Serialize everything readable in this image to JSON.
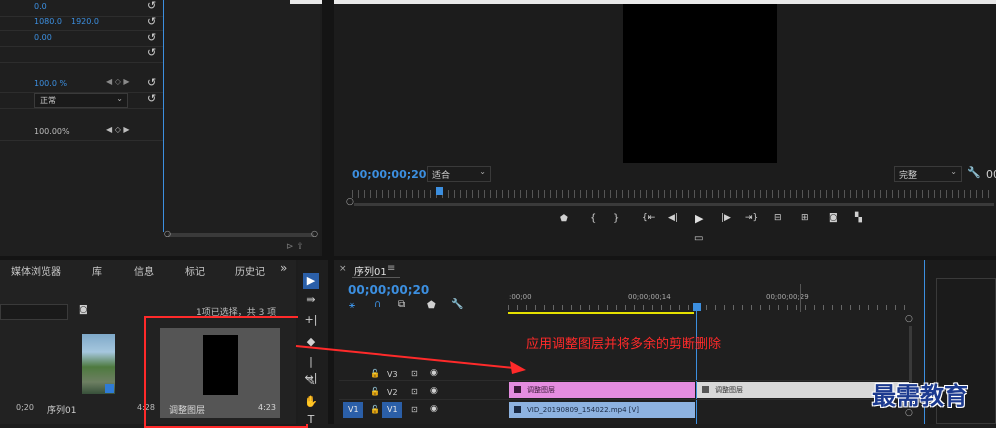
{
  "colors": {
    "accent_blue": "#3c8fe0",
    "adjustment_clip": "#e58de0",
    "video_clip": "#8db2e0",
    "annotation_red": "#ff2a2a",
    "playhead": "#3c8fe0",
    "work_area": "#e5e000"
  },
  "effect_controls": {
    "rows": [
      {
        "value_a": "0.0",
        "value_b": ""
      },
      {
        "value_a": "1080.0",
        "value_b": "1920.0"
      },
      {
        "value_a": "0.00",
        "value_b": ""
      },
      {
        "value_a": "",
        "value_b": ""
      },
      {
        "value_a": "100.0 %",
        "value_b": ""
      },
      {
        "value_a": "正常",
        "value_b": ""
      },
      {
        "value_a": "100.00%",
        "value_b": ""
      }
    ]
  },
  "program_monitor": {
    "timecode": "00;00;00;20",
    "fit": "适合",
    "quality": "完整",
    "trailing": "00"
  },
  "project_panel": {
    "tabs": [
      "媒体浏览器",
      "库",
      "信息",
      "标记",
      "历史记"
    ],
    "more": "»",
    "selection_info": "1项已选择，共 3 项",
    "items": [
      {
        "label": "序列01",
        "duration": "4:28",
        "left_duration": "0;20"
      },
      {
        "label": "调整图层",
        "duration": "4:23"
      }
    ]
  },
  "timeline": {
    "tab_title": "序列01",
    "menu": "≡",
    "close": "×",
    "timecode": "00;00;00;20",
    "ruler_labels": [
      ":00;00",
      "00;00;00;14",
      "00;00;00;29"
    ],
    "tracks": [
      {
        "name": "V3"
      },
      {
        "name": "V2"
      },
      {
        "name": "V1",
        "source": "V1"
      }
    ],
    "clips": [
      {
        "track": "V2",
        "label": "调整图层",
        "selected": true
      },
      {
        "track": "V2",
        "label": "调整图层",
        "selected": false
      },
      {
        "track": "V1",
        "label": "VID_20190809_154022.mp4 [V]"
      }
    ],
    "annotation": "应用调整图层并将多余的剪断删除"
  },
  "watermark": "最需教育"
}
